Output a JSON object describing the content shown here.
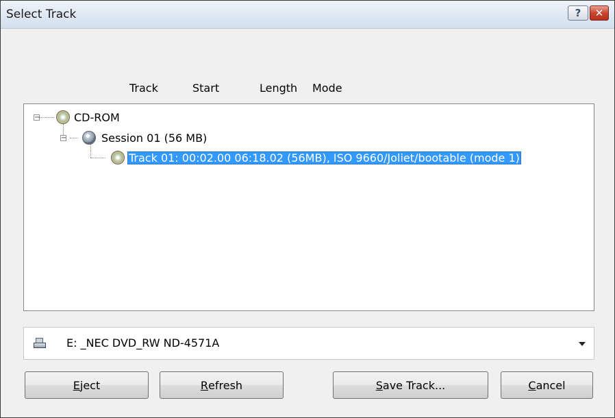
{
  "window": {
    "title": "Select Track",
    "help_label": "?",
    "close_label": "✕"
  },
  "columns": {
    "track": "Track",
    "start": "Start",
    "length": "Length",
    "mode": "Mode"
  },
  "tree": {
    "root": {
      "label": "CD-ROM",
      "expander": "−"
    },
    "session": {
      "label": "Session 01 (56 MB)",
      "expander": "−"
    },
    "track": {
      "label": "Track 01: 00:02.00 06:18.02 (56MB), ISO 9660/Joliet/bootable (mode 1)",
      "selected": true
    }
  },
  "drive": {
    "selected": "E: _NEC DVD_RW ND-4571A",
    "icon": "drive-icon"
  },
  "buttons": {
    "eject": {
      "mnemonic": "E",
      "rest": "ject"
    },
    "refresh": {
      "mnemonic": "R",
      "rest": "efresh"
    },
    "save_track": {
      "mnemonic": "S",
      "rest": "ave Track..."
    },
    "cancel": {
      "mnemonic": "C",
      "rest": "ancel"
    }
  },
  "colors": {
    "selection": "#3399ff",
    "close_button": "#c9452f"
  }
}
